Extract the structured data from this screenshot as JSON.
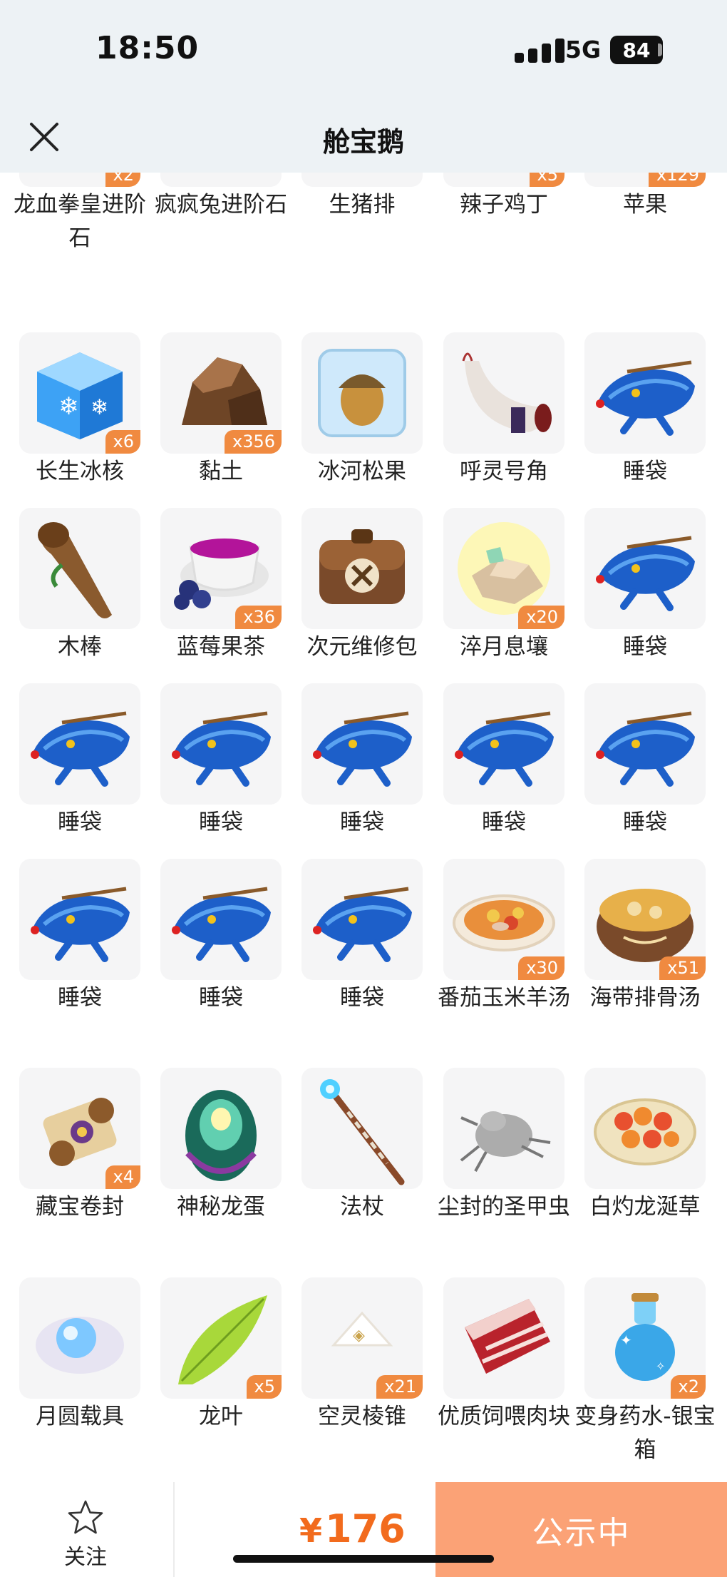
{
  "status_bar": {
    "time": "18:50",
    "network": "5G",
    "battery": "84"
  },
  "nav": {
    "title": "舱宝鹅",
    "close_icon": "close-icon"
  },
  "colors": {
    "accent": "#f26b1d",
    "cta_background": "#fba276",
    "badge": "#f08a40",
    "tile_background": "#f5f5f6"
  },
  "items": [
    {
      "name": "龙血拳皇进阶石",
      "qty": "x2",
      "icon": "purple-gem"
    },
    {
      "name": "疯疯兔进阶石",
      "qty": "",
      "icon": "purple-gem"
    },
    {
      "name": "生猪排",
      "qty": "",
      "icon": "raw-pork"
    },
    {
      "name": "辣子鸡丁",
      "qty": "x5",
      "icon": "spicy-chicken"
    },
    {
      "name": "苹果",
      "qty": "x129",
      "icon": "apple"
    },
    {
      "name": "长生冰核",
      "qty": "x6",
      "icon": "ice-cube"
    },
    {
      "name": "黏土",
      "qty": "x356",
      "icon": "clay-rock"
    },
    {
      "name": "冰河松果",
      "qty": "",
      "icon": "frozen-acorn"
    },
    {
      "name": "呼灵号角",
      "qty": "",
      "icon": "horn"
    },
    {
      "name": "睡袋",
      "qty": "",
      "icon": "sleeping-bag"
    },
    {
      "name": "木棒",
      "qty": "",
      "icon": "wooden-club"
    },
    {
      "name": "蓝莓果茶",
      "qty": "x36",
      "icon": "blueberry-tea"
    },
    {
      "name": "次元维修包",
      "qty": "",
      "icon": "repair-bag"
    },
    {
      "name": "淬月息壤",
      "qty": "x20",
      "icon": "glowing-soil"
    },
    {
      "name": "睡袋",
      "qty": "",
      "icon": "sleeping-bag"
    },
    {
      "name": "睡袋",
      "qty": "",
      "icon": "sleeping-bag"
    },
    {
      "name": "睡袋",
      "qty": "",
      "icon": "sleeping-bag"
    },
    {
      "name": "睡袋",
      "qty": "",
      "icon": "sleeping-bag"
    },
    {
      "name": "睡袋",
      "qty": "",
      "icon": "sleeping-bag"
    },
    {
      "name": "睡袋",
      "qty": "",
      "icon": "sleeping-bag"
    },
    {
      "name": "睡袋",
      "qty": "",
      "icon": "sleeping-bag"
    },
    {
      "name": "睡袋",
      "qty": "",
      "icon": "sleeping-bag"
    },
    {
      "name": "睡袋",
      "qty": "",
      "icon": "sleeping-bag"
    },
    {
      "name": "番茄玉米羊汤",
      "qty": "x30",
      "icon": "tomato-soup"
    },
    {
      "name": "海带排骨汤",
      "qty": "x51",
      "icon": "kelp-soup"
    },
    {
      "name": "藏宝卷封",
      "qty": "x4",
      "icon": "treasure-scroll"
    },
    {
      "name": "神秘龙蛋",
      "qty": "",
      "icon": "dragon-egg"
    },
    {
      "name": "法杖",
      "qty": "",
      "icon": "magic-staff"
    },
    {
      "name": "尘封的圣甲虫",
      "qty": "",
      "icon": "beetle"
    },
    {
      "name": "白灼龙涎草",
      "qty": "",
      "icon": "veggie-plate"
    },
    {
      "name": "月圆载具",
      "qty": "",
      "icon": "moon-orb"
    },
    {
      "name": "龙叶",
      "qty": "x5",
      "icon": "green-leaf"
    },
    {
      "name": "空灵棱锥",
      "qty": "x21",
      "icon": "pyramid"
    },
    {
      "name": "优质饲喂肉块",
      "qty": "",
      "icon": "meat-block"
    },
    {
      "name": "变身药水-银宝箱",
      "qty": "x2",
      "icon": "potion"
    }
  ],
  "bottom_bar": {
    "favorite_label": "关注",
    "favorite_icon": "star-outline-icon",
    "currency": "¥",
    "price": "176",
    "action_label": "公示中"
  }
}
